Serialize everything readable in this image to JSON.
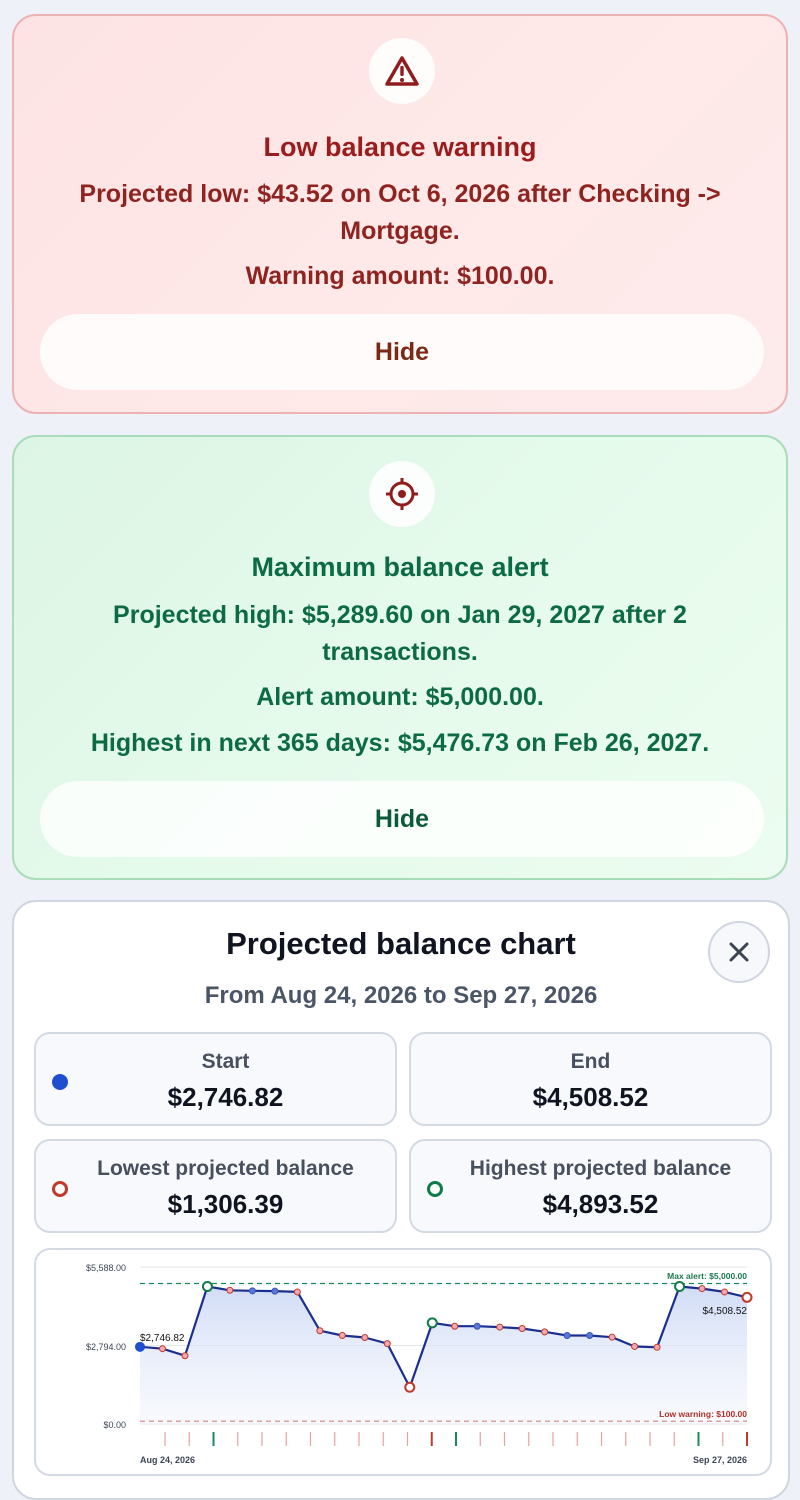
{
  "low_warning": {
    "title": "Low balance warning",
    "line1": "Projected low: $43.52 on Oct 6, 2026 after Checking -> Mortgage.",
    "line2": "Warning amount: $100.00.",
    "hide_label": "Hide",
    "icon": "warning-triangle-icon",
    "accent": "#9b1c1c"
  },
  "max_alert": {
    "title": "Maximum balance alert",
    "line1": "Projected high: $5,289.60 on Jan 29, 2027 after 2 transactions.",
    "line2": "Alert amount: $5,000.00.",
    "line3": "Highest in next 365 days: $5,476.73 on Feb 26, 2027.",
    "hide_label": "Hide",
    "icon": "target-icon",
    "accent": "#0d6b43"
  },
  "chart_panel": {
    "title": "Projected balance chart",
    "subtitle": "From Aug 24, 2026 to Sep 27, 2026",
    "close_icon": "close-icon",
    "stats": {
      "start": {
        "label": "Start",
        "value": "$2,746.82",
        "color": "#1f4fd1"
      },
      "end": {
        "label": "End",
        "value": "$4,508.52"
      },
      "lowest": {
        "label": "Lowest projected balance",
        "value": "$1,306.39",
        "color": "#c0392b"
      },
      "highest": {
        "label": "Highest projected balance",
        "value": "$4,893.52",
        "color": "#0f7a4a"
      }
    }
  },
  "chart_data": {
    "type": "line",
    "x_start_label": "Aug 24, 2026",
    "x_end_label": "Sep 27, 2026",
    "y_ticks": [
      "$5,588.00",
      "$2,794.00",
      "$0.00"
    ],
    "ylim": [
      0,
      5588
    ],
    "max_alert": {
      "value": 5000,
      "label": "Max alert: $5,000.00",
      "color": "#1b8a5a"
    },
    "low_warning": {
      "value": 100,
      "label": "Low warning: $100.00",
      "color": "#c0392b"
    },
    "start_annotation": "$2,746.82",
    "end_annotation": "$4,508.52",
    "series": [
      {
        "values": [
          2746.82,
          2680,
          2430,
          4893.52,
          4760,
          4740,
          4730,
          4700,
          3320,
          3150,
          3080,
          2860,
          1306.39,
          3600,
          3480,
          3480,
          3450,
          3400,
          3280,
          3150,
          3150,
          3090,
          2760,
          2730,
          4893.52,
          4820,
          4700,
          4508.52
        ],
        "marker_types": [
          "start",
          "dec",
          "dec",
          "high",
          "dec",
          "plain",
          "plain",
          "dec",
          "dec",
          "dec",
          "dec",
          "dec",
          "low",
          "high",
          "dec",
          "plain",
          "dec",
          "dec",
          "dec",
          "plain",
          "plain",
          "dec",
          "dec",
          "dec",
          "high",
          "dec",
          "dec",
          "low"
        ]
      }
    ],
    "event_ticks": [
      "red",
      "red",
      "green",
      "red",
      "red",
      "red",
      "red",
      "red",
      "red",
      "red",
      "red",
      "darkred",
      "green",
      "red",
      "red",
      "red",
      "red",
      "red",
      "red",
      "red",
      "red",
      "red",
      "green",
      "red",
      "darkred"
    ]
  }
}
